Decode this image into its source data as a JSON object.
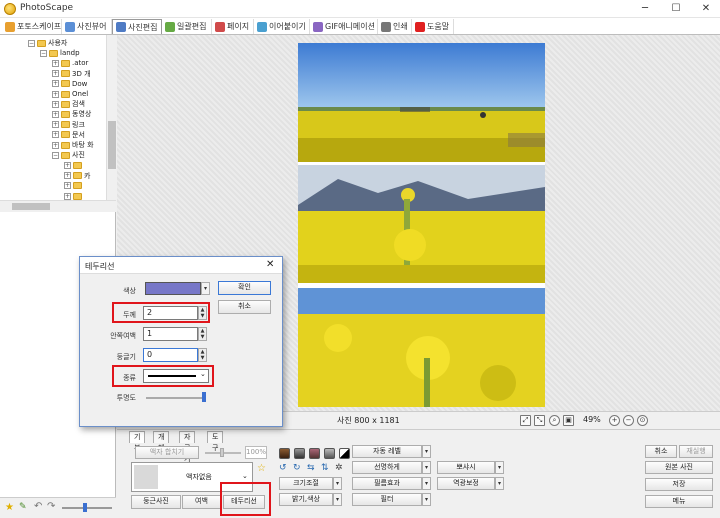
{
  "window": {
    "title": "PhotoScape",
    "minimize": "─",
    "maximize": "☐",
    "close": "✕"
  },
  "tabs": [
    {
      "label": "포토스케이프",
      "icon": "photoscape-icon",
      "color": "#e8a030"
    },
    {
      "label": "사진뷰어",
      "icon": "viewer-icon",
      "color": "#5b8fd6"
    },
    {
      "label": "사진편집",
      "icon": "editor-icon",
      "color": "#4f7bc4"
    },
    {
      "label": "일괄편집",
      "icon": "batch-icon",
      "color": "#66aa44"
    },
    {
      "label": "페이지",
      "icon": "page-icon",
      "color": "#d04a4a"
    },
    {
      "label": "이어붙이기",
      "icon": "combine-icon",
      "color": "#4aa0d0"
    },
    {
      "label": "GIF애니메이션",
      "icon": "gif-icon",
      "color": "#8a66c2"
    },
    {
      "label": "인쇄",
      "icon": "print-icon",
      "color": "#777777"
    },
    {
      "label": "도움말",
      "icon": "help-icon",
      "color": "#e02020"
    }
  ],
  "tree": [
    {
      "label": "사용자",
      "indent": 3
    },
    {
      "label": "landp",
      "indent": 4
    },
    {
      "label": ".ator",
      "indent": 5
    },
    {
      "label": "3D 개",
      "indent": 5
    },
    {
      "label": "Dow",
      "indent": 5
    },
    {
      "label": "Onel",
      "indent": 5
    },
    {
      "label": "검색",
      "indent": 5
    },
    {
      "label": "동영상",
      "indent": 5
    },
    {
      "label": "링크",
      "indent": 5
    },
    {
      "label": "문서",
      "indent": 5
    },
    {
      "label": "바탕 화",
      "indent": 5
    },
    {
      "label": "사진",
      "indent": 5
    },
    {
      "label": "",
      "indent": 6
    },
    {
      "label": "카",
      "indent": 6
    },
    {
      "label": "",
      "indent": 6
    },
    {
      "label": "",
      "indent": 6
    }
  ],
  "status": {
    "info": "사진 800 x 1181",
    "zoom": "49%"
  },
  "bottom": {
    "tabs": [
      "기본",
      "개체",
      "자르기",
      "도구"
    ],
    "frame_combo_label": "액자 합치기",
    "frame_percent": "100%",
    "frame_name": "액자없음",
    "round_photo": "둥근사진",
    "margin": "여백",
    "border": "테두리선",
    "auto_level": "자동 레벨",
    "sharpen": "선명하게",
    "bloom": "뽀샤시",
    "film_effect": "필름효과",
    "backlight": "역광보정",
    "resize": "크기조절",
    "bright_color": "밝기,색상",
    "filter": "필터",
    "cancel": "취소",
    "redo": "재실행",
    "original": "원본 사진",
    "save": "저장",
    "menu": "메뉴"
  },
  "dialog": {
    "title": "테두리선",
    "close": "✕",
    "color_label": "색상",
    "color_value": "#7777c8",
    "thickness_label": "두께",
    "thickness_value": "2",
    "inner_margin_label": "안쪽여백",
    "inner_margin_value": "1",
    "roundness_label": "둥글기",
    "roundness_value": "0",
    "type_label": "종류",
    "opacity_label": "투명도",
    "opacity": 1.0,
    "ok": "확인",
    "cancel": "취소"
  }
}
